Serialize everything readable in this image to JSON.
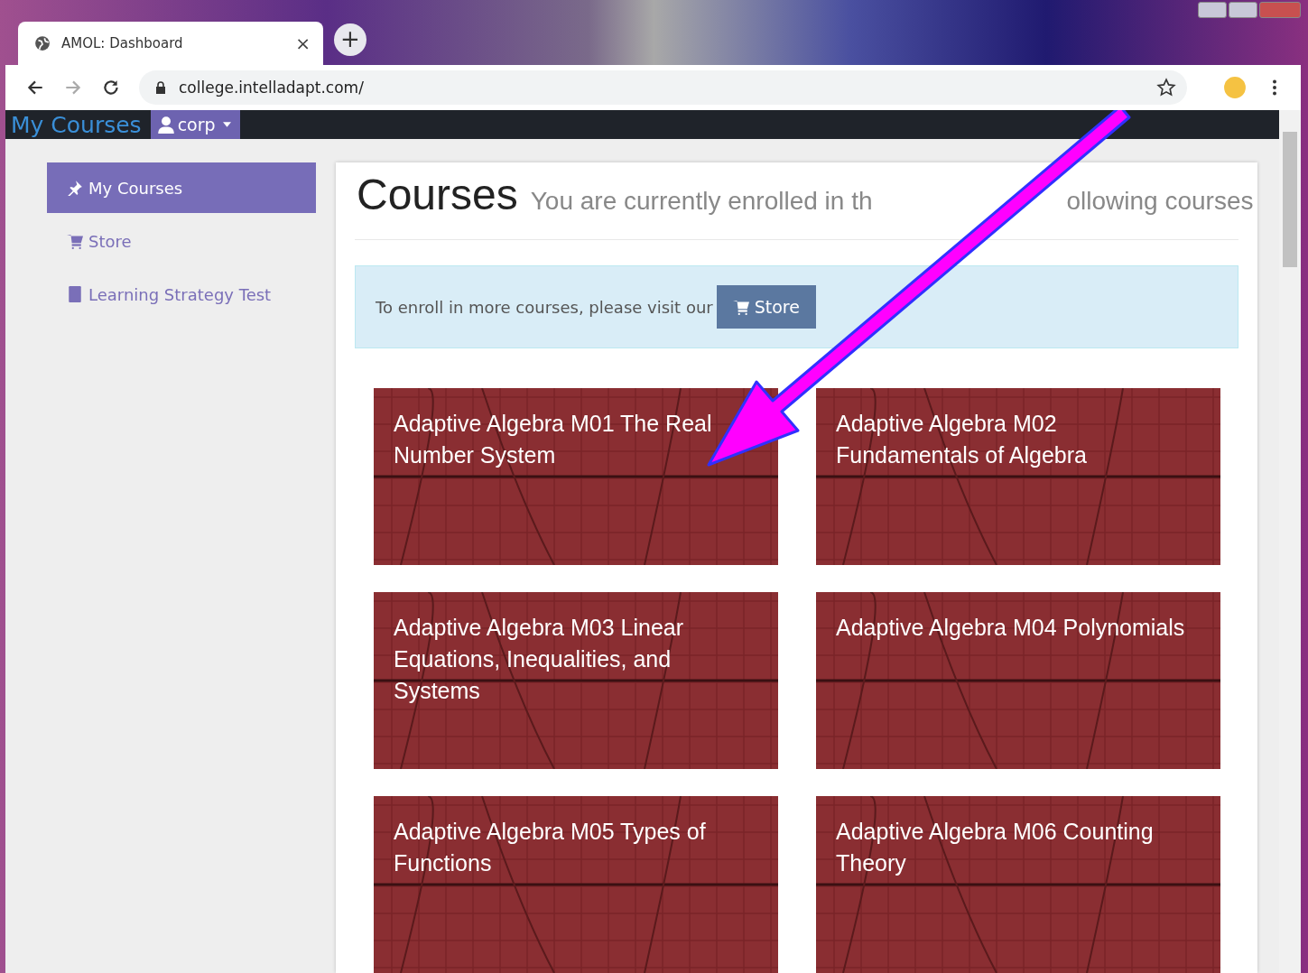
{
  "browser": {
    "tab_title": "AMOL: Dashboard",
    "tab_close": "×",
    "new_tab": "+",
    "url": "college.intelladapt.com/"
  },
  "navbar": {
    "brand": "My Courses",
    "user": "corp"
  },
  "sidebar": {
    "items": [
      {
        "label": "My Courses",
        "selected": true
      },
      {
        "label": "Store",
        "selected": false
      },
      {
        "label": "Learning Strategy Test",
        "selected": false
      }
    ]
  },
  "page": {
    "title": "Courses",
    "subtitle_start": "You are currently enrolled in th",
    "subtitle_end": "ollowing courses"
  },
  "alert": {
    "text": "To enroll in more courses, please visit our",
    "button": "Store"
  },
  "courses": [
    {
      "title": "Adaptive Algebra M01 The Real Number System"
    },
    {
      "title": "Adaptive Algebra M02 Fundamentals of Algebra"
    },
    {
      "title": "Adaptive Algebra M03 Linear Equations, Inequalities, and Systems"
    },
    {
      "title": "Adaptive Algebra M04 Polynomials"
    },
    {
      "title": "Adaptive Algebra M05 Types of Functions"
    },
    {
      "title": "Adaptive Algebra M06 Counting Theory"
    }
  ]
}
